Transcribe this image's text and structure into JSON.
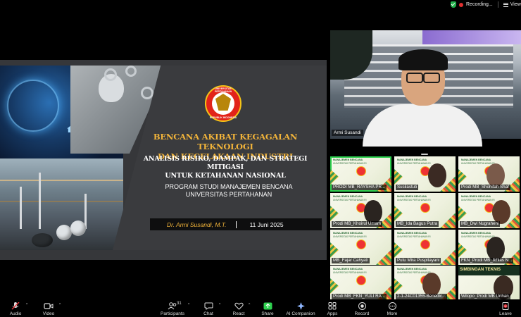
{
  "status": {
    "recording": "Recording...",
    "view": "View"
  },
  "slide": {
    "logo_top": "UNIVERSITAS PERTAHANAN",
    "logo_bottom": "REPUBLIK INDONESIA",
    "title_line1": "BENCANA AKIBAT KEGAGALAN TEKNOLOGI",
    "title_line2": "DAN KECELAKAAN INDUSTRI",
    "subtitle_line1": "ANALISIS RISIKO, DAMPAK, DAN STRATEGI MITIGASI",
    "subtitle_line2": "UNTUK KETAHANAN NASIONAL",
    "program_line1": "PROGRAM STUDI MANAJEMEN BENCANA",
    "program_line2": "UNIVERSITAS PERTAHANAN",
    "presenter": "Dr. Armi Susandi, M.T.",
    "date": "11 Juni 2025"
  },
  "main_camera": {
    "name": "Armi Susandi"
  },
  "tiles": [
    {
      "label": "PRODI MB_RAYSHA PR...",
      "type": "banner",
      "active": true
    },
    {
      "label": "Susilastuti",
      "type": "face",
      "active": false
    },
    {
      "label": "Prodi MB_Shohifah Shaf",
      "type": "face",
      "active": false
    },
    {
      "label": "Prodi MB_Khoirul Umam",
      "type": "face",
      "active": false
    },
    {
      "label": "MB_Ida Bagus Putra",
      "type": "banner",
      "active": false
    },
    {
      "label": "MB_Dwi Nugraheni",
      "type": "face",
      "active": false
    },
    {
      "label": "MB_Fajar Cahyati",
      "type": "banner",
      "active": false
    },
    {
      "label": "Putu Mira Puspitayani",
      "type": "banner",
      "active": false
    },
    {
      "label": "FKN_Prodi MB_Ikhlas N...",
      "type": "face",
      "active": false
    },
    {
      "label": "Prodi MB_FKN_YULI RA...",
      "type": "banner",
      "active": false
    },
    {
      "label": "2-1-24C01355-Benedic...",
      "type": "face",
      "active": false
    },
    {
      "label": "Wilopo_Prodi MB Unhan",
      "type": "dark",
      "active": false
    }
  ],
  "tile_banner": {
    "head": "MANAJEMEN BENCANA",
    "sub": "UNIVERSITAS PERTAHANAN RI",
    "dark_banner": "SIMBINGAN TEKNIS"
  },
  "toolbar": {
    "audio": "Audio",
    "video": "Video",
    "participants": "Participants",
    "participants_count": "31",
    "chat": "Chat",
    "react": "React",
    "share": "Share",
    "ai_companion": "AI Companion",
    "apps": "Apps",
    "record": "Record",
    "more": "More",
    "leave": "Leave"
  },
  "colors": {
    "accent_gold": "#f2b43a",
    "share_green": "#2ed14f",
    "leave_red": "#e5343a",
    "recording_red": "#e03030"
  }
}
